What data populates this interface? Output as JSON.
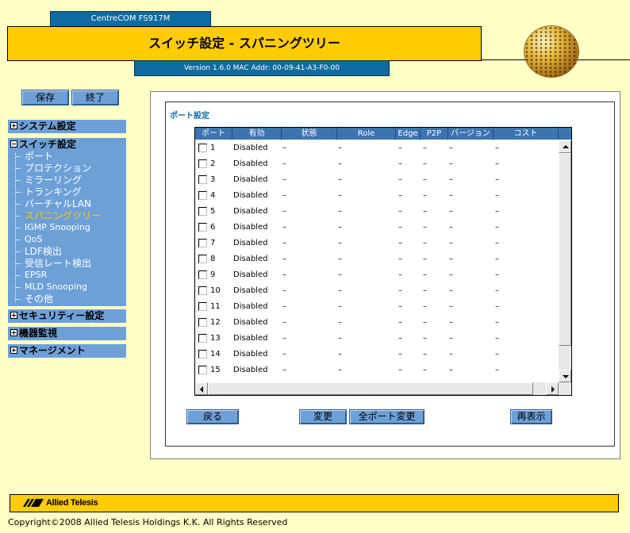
{
  "header": {
    "product": "CentreCOM FS917M",
    "title": "スイッチ設定 - スパニングツリー",
    "version": "Version 1.6.0 MAC Addr: 00-09-41-A3-F0-00"
  },
  "toolbar": {
    "save_label": "保存",
    "exit_label": "終了"
  },
  "sidebar": {
    "system": "システム設定",
    "switch": "スイッチ設定",
    "items": [
      "ポート",
      "プロテクション",
      "ミラーリング",
      "トランキング",
      "バーチャルLAN",
      "スパニングツリー",
      "IGMP Snooping",
      "QoS",
      "LDF検出",
      "受信レート検出",
      "EPSR",
      "MLD Snooping",
      "その他"
    ],
    "active_index": 5,
    "security": "セキュリティー設定",
    "monitor": "機器監視",
    "management": "マネージメント"
  },
  "main": {
    "section_title": "ポート設定",
    "columns": [
      "ポート",
      "有効",
      "状態",
      "Role",
      "Edge",
      "P2P",
      "バージョン",
      "コスト"
    ],
    "rows": [
      {
        "port": "1",
        "enabled": "Disabled",
        "state": "–",
        "role": "–",
        "edge": "–",
        "p2p": "–",
        "version": "–",
        "cost": "–"
      },
      {
        "port": "2",
        "enabled": "Disabled",
        "state": "–",
        "role": "–",
        "edge": "–",
        "p2p": "–",
        "version": "–",
        "cost": "–"
      },
      {
        "port": "3",
        "enabled": "Disabled",
        "state": "–",
        "role": "–",
        "edge": "–",
        "p2p": "–",
        "version": "–",
        "cost": "–"
      },
      {
        "port": "4",
        "enabled": "Disabled",
        "state": "–",
        "role": "–",
        "edge": "–",
        "p2p": "–",
        "version": "–",
        "cost": "–"
      },
      {
        "port": "5",
        "enabled": "Disabled",
        "state": "–",
        "role": "–",
        "edge": "–",
        "p2p": "–",
        "version": "–",
        "cost": "–"
      },
      {
        "port": "6",
        "enabled": "Disabled",
        "state": "–",
        "role": "–",
        "edge": "–",
        "p2p": "–",
        "version": "–",
        "cost": "–"
      },
      {
        "port": "7",
        "enabled": "Disabled",
        "state": "–",
        "role": "–",
        "edge": "–",
        "p2p": "–",
        "version": "–",
        "cost": "–"
      },
      {
        "port": "8",
        "enabled": "Disabled",
        "state": "–",
        "role": "–",
        "edge": "–",
        "p2p": "–",
        "version": "–",
        "cost": "–"
      },
      {
        "port": "9",
        "enabled": "Disabled",
        "state": "–",
        "role": "–",
        "edge": "–",
        "p2p": "–",
        "version": "–",
        "cost": "–"
      },
      {
        "port": "10",
        "enabled": "Disabled",
        "state": "–",
        "role": "–",
        "edge": "–",
        "p2p": "–",
        "version": "–",
        "cost": "–"
      },
      {
        "port": "11",
        "enabled": "Disabled",
        "state": "–",
        "role": "–",
        "edge": "–",
        "p2p": "–",
        "version": "–",
        "cost": "–"
      },
      {
        "port": "12",
        "enabled": "Disabled",
        "state": "–",
        "role": "–",
        "edge": "–",
        "p2p": "–",
        "version": "–",
        "cost": "–"
      },
      {
        "port": "13",
        "enabled": "Disabled",
        "state": "–",
        "role": "–",
        "edge": "–",
        "p2p": "–",
        "version": "–",
        "cost": "–"
      },
      {
        "port": "14",
        "enabled": "Disabled",
        "state": "–",
        "role": "–",
        "edge": "–",
        "p2p": "–",
        "version": "–",
        "cost": "–"
      },
      {
        "port": "15",
        "enabled": "Disabled",
        "state": "–",
        "role": "–",
        "edge": "–",
        "p2p": "–",
        "version": "–",
        "cost": "–"
      }
    ],
    "buttons": {
      "back": "戻る",
      "change": "変更",
      "change_all": "全ポート変更",
      "refresh": "再表示"
    }
  },
  "footer": {
    "logo": "Allied Telesis",
    "copyright": "Copyright©2008 Allied Telesis Holdings K.K. All Rights Reserved"
  },
  "colors": {
    "accent_blue": "#0f6ba0",
    "nav_blue": "#6ea0d8",
    "highlight_yellow": "#ffcc00",
    "background": "#ffffc6"
  }
}
